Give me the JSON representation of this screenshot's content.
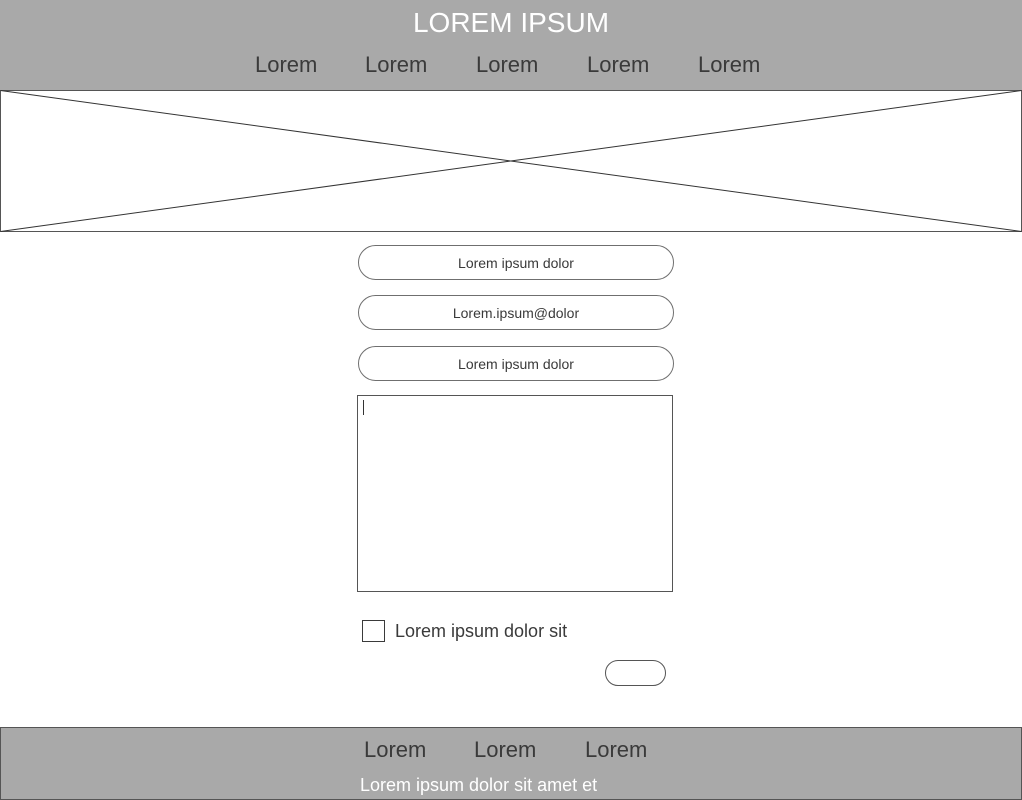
{
  "header": {
    "title": "LOREM IPSUM",
    "nav": [
      "Lorem",
      "Lorem",
      "Lorem",
      "Lorem",
      "Lorem"
    ]
  },
  "hero": {
    "icon": "image-placeholder-icon"
  },
  "form": {
    "name_value": "Lorem ipsum dolor",
    "email_value": "Lorem.ipsum@dolor",
    "subject_value": "Lorem ipsum dolor",
    "message_value": "",
    "checkbox_label": "Lorem ipsum dolor sit",
    "checkbox_checked": false,
    "submit_label": ""
  },
  "footer": {
    "links": [
      "Lorem",
      "Lorem",
      "Lorem"
    ],
    "text": "Lorem ipsum dolor sit amet et"
  },
  "colors": {
    "bar_background": "#a9a9a9",
    "title_text": "#ffffff",
    "nav_text": "#3a3a3a"
  }
}
